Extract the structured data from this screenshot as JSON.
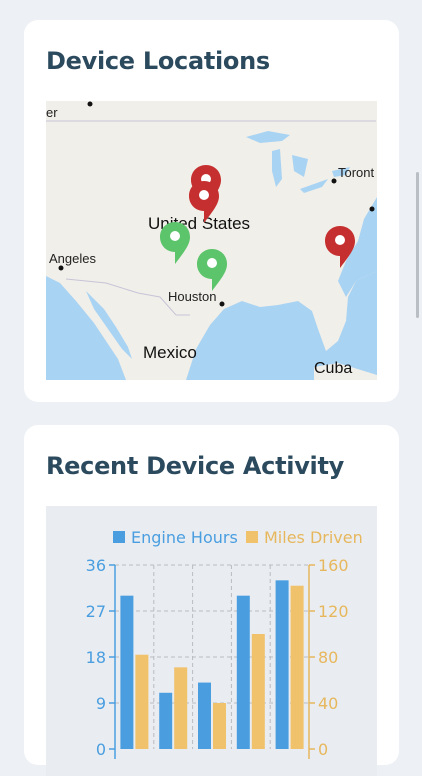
{
  "map_card": {
    "title": "Device Locations",
    "labels": {
      "west_edge": "er",
      "toronto": "Toront",
      "us": "United States",
      "la": "Angeles",
      "houston": "Houston",
      "mexico": "Mexico",
      "cuba": "Cuba"
    },
    "pin_colors": {
      "alert": "#c62f2f",
      "ok": "#5cc46b"
    }
  },
  "activity_card": {
    "title": "Recent Device Activity",
    "chart_data": {
      "type": "bar",
      "categories": [
        "",
        "",
        "",
        "",
        ""
      ],
      "series": [
        {
          "name": "Engine Hours",
          "axis": "left",
          "color": "#4a9ee0",
          "values": [
            30,
            11,
            13,
            30,
            33
          ]
        },
        {
          "name": "Miles Driven",
          "axis": "right",
          "color": "#f0c26c",
          "values": [
            82,
            71,
            40,
            100,
            142
          ]
        }
      ],
      "left_axis": {
        "ticks": [
          "36",
          "27",
          "18",
          "9",
          "0"
        ],
        "range": [
          0,
          36
        ],
        "color": "#4a9ee0"
      },
      "right_axis": {
        "ticks": [
          "160",
          "120",
          "80",
          "40",
          "0"
        ],
        "range": [
          0,
          160
        ],
        "color": "#e7b75d"
      },
      "legend_position": "top",
      "grid": true
    }
  }
}
